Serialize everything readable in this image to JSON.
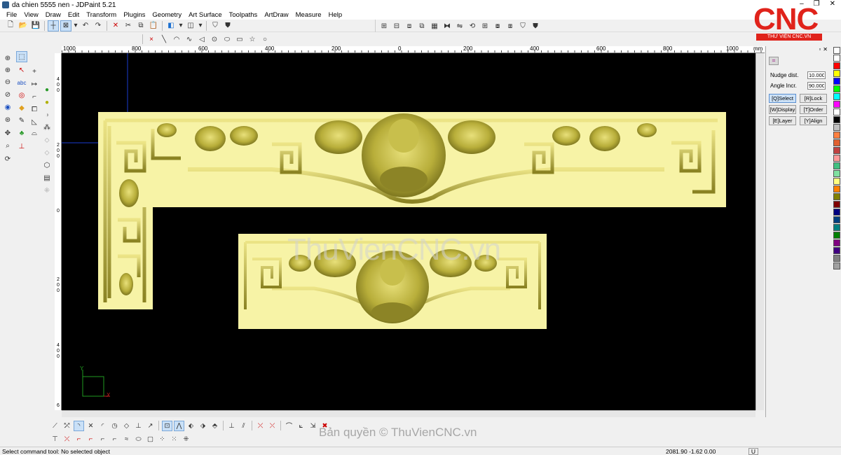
{
  "window": {
    "title": "da chien 5555 nen - JDPaint 5.21",
    "controls": [
      "–",
      "❐",
      "✕"
    ]
  },
  "menu": [
    "File",
    "View",
    "Draw",
    "Edit",
    "Transform",
    "Plugins",
    "Geometry",
    "Art Surface",
    "Toolpaths",
    "ArtDraw",
    "Measure",
    "Help"
  ],
  "logo": {
    "text": "CNC",
    "subtitle": "THƯ VIỆN CNC.VN",
    "color": "#e0231b"
  },
  "ruler": {
    "top_labels": [
      "1000",
      "800",
      "600",
      "400",
      "200",
      "0",
      "200",
      "400",
      "600",
      "800",
      "1000",
      "mm"
    ],
    "left_labels": [
      "4",
      "0",
      "0",
      "2",
      "0",
      "0",
      "0",
      "2",
      "0",
      "0",
      "4",
      "0",
      "0",
      "6"
    ]
  },
  "canvas": {
    "background": "#000000",
    "relief_color": "#f7f3a6",
    "axis_label_y": "Y",
    "axis_label_x": "X"
  },
  "watermark": {
    "canvas_text": "ThuVienCNC.vn",
    "footer_text": "Bản quyền © ThuVienCNC.vn"
  },
  "panel": {
    "nudge_label": "Nudge dist.",
    "nudge_value": "10.000",
    "angle_label": "Angle Incr.",
    "angle_value": "90.000",
    "buttons": [
      {
        "label": "[Q]Select",
        "active": true
      },
      {
        "label": "[R]Lock",
        "active": false
      },
      {
        "label": "[W]Display",
        "active": false
      },
      {
        "label": "[T]Order",
        "active": false
      },
      {
        "label": "[E]Layer",
        "active": false
      },
      {
        "label": "[Y]Align",
        "active": false
      }
    ]
  },
  "palette": [
    "#ffffff",
    "#ffffff",
    "#ff0000",
    "#ffff00",
    "#0000ff",
    "#00ff00",
    "#00ffff",
    "#ff00ff",
    "#ffffff",
    "#000000",
    "#c0c0c0",
    "#ff8040",
    "#e06030",
    "#c04040",
    "#ff9999",
    "#40c080",
    "#80e0a0",
    "#ffff80",
    "#ff8000",
    "#808000",
    "#800000",
    "#000080",
    "#004080",
    "#008080",
    "#008000",
    "#800080",
    "#400080",
    "#808080",
    "#a0a0a0"
  ],
  "status": {
    "message": "Select command tool: No selected object",
    "coords": "2081.90 -1.62 0.00",
    "unit": "U"
  }
}
